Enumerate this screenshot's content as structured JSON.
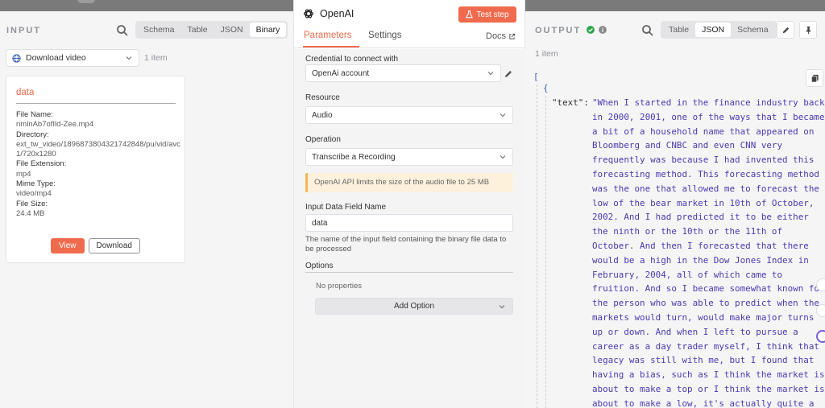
{
  "input": {
    "title": "INPUT",
    "tabs": [
      "Schema",
      "Table",
      "JSON",
      "Binary"
    ],
    "active_tab": "Binary",
    "select_value": "Download video",
    "item_count": "1 item",
    "card": {
      "title": "data",
      "fields": [
        {
          "key": "File Name:",
          "value": "nmlnAb7ofIld-Zee.mp4"
        },
        {
          "key": "Directory:",
          "value": "ext_tw_video/1896873804321742848/pu/vid/avc1/720x1280"
        },
        {
          "key": "File Extension:",
          "value": "mp4"
        },
        {
          "key": "Mime Type:",
          "value": "video/mp4"
        },
        {
          "key": "File Size:",
          "value": "24.4 MB"
        }
      ],
      "view_label": "View",
      "download_label": "Download"
    }
  },
  "node": {
    "title": "OpenAI",
    "test_label": "Test step",
    "tabs": {
      "parameters": "Parameters",
      "settings": "Settings"
    },
    "docs_label": "Docs",
    "credential_label": "Credential to connect with",
    "credential_value": "OpenAi account",
    "resource_label": "Resource",
    "resource_value": "Audio",
    "operation_label": "Operation",
    "operation_value": "Transcribe a Recording",
    "notice": "OpenAI API limits the size of the audio file to 25 MB",
    "input_field_label": "Input Data Field Name",
    "input_field_value": "data",
    "input_field_hint": "The name of the input field containing the binary file data to be processed",
    "options_label": "Options",
    "no_properties": "No properties",
    "add_option_label": "Add Option"
  },
  "output": {
    "title": "OUTPUT",
    "tabs": [
      "Table",
      "JSON",
      "Schema"
    ],
    "active_tab": "JSON",
    "item_count": "1 item",
    "json": {
      "open_bracket": "[",
      "open_brace": "{",
      "key": "\"text\":",
      "value": "\"When I started in the finance industry back in 2000, 2001, one of the ways that I became a bit of a household name that appeared on Bloomberg and CNBC and even CNN very frequently was because I had invented this forecasting method. This forecasting method was the one that allowed me to forecast the low of the bear market in 10th of October, 2002. And I had predicted it to be either the ninth or the 10th or the 11th of October. And then I forecasted that there would be a high in the Dow Jones Index in February, 2004, all of which came to fruition. And so I became somewhat known for the person who was able to predict when the markets would turn, would make major turns up or down. And when I left to pursue a career as a day trader myself, I think that legacy was still with me, but I found that having a bias, such as I think the market is about to make a top or I think the market is about to make a low, it's actually quite a dangerous trait to possess as a"
    }
  },
  "colors": {
    "accent": "#f06b4d",
    "success": "#29a34a",
    "json_string": "#4a3bb0",
    "notice_bg": "#fdf1dc"
  }
}
